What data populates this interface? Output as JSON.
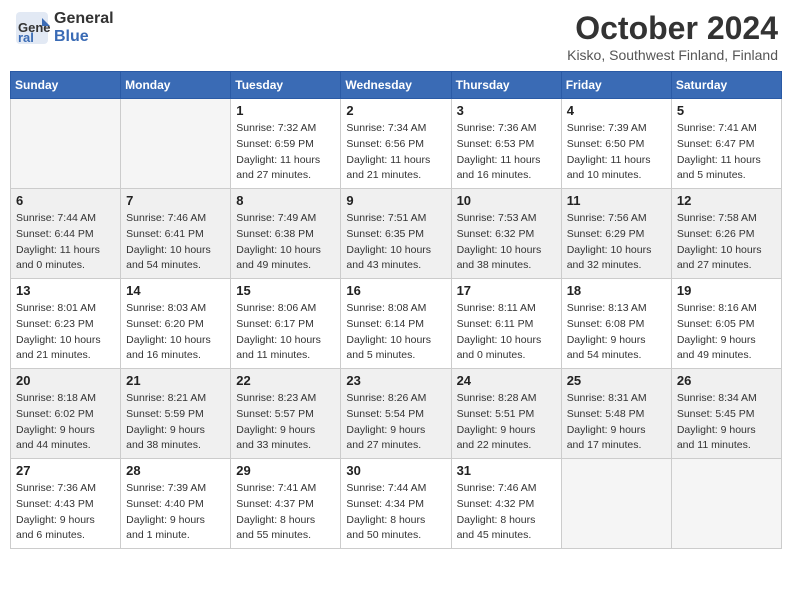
{
  "header": {
    "logo_line1": "General",
    "logo_line2": "Blue",
    "month": "October 2024",
    "location": "Kisko, Southwest Finland, Finland"
  },
  "weekdays": [
    "Sunday",
    "Monday",
    "Tuesday",
    "Wednesday",
    "Thursday",
    "Friday",
    "Saturday"
  ],
  "weeks": [
    [
      {
        "day": "",
        "info": ""
      },
      {
        "day": "",
        "info": ""
      },
      {
        "day": "1",
        "info": "Sunrise: 7:32 AM\nSunset: 6:59 PM\nDaylight: 11 hours and 27 minutes."
      },
      {
        "day": "2",
        "info": "Sunrise: 7:34 AM\nSunset: 6:56 PM\nDaylight: 11 hours and 21 minutes."
      },
      {
        "day": "3",
        "info": "Sunrise: 7:36 AM\nSunset: 6:53 PM\nDaylight: 11 hours and 16 minutes."
      },
      {
        "day": "4",
        "info": "Sunrise: 7:39 AM\nSunset: 6:50 PM\nDaylight: 11 hours and 10 minutes."
      },
      {
        "day": "5",
        "info": "Sunrise: 7:41 AM\nSunset: 6:47 PM\nDaylight: 11 hours and 5 minutes."
      }
    ],
    [
      {
        "day": "6",
        "info": "Sunrise: 7:44 AM\nSunset: 6:44 PM\nDaylight: 11 hours and 0 minutes."
      },
      {
        "day": "7",
        "info": "Sunrise: 7:46 AM\nSunset: 6:41 PM\nDaylight: 10 hours and 54 minutes."
      },
      {
        "day": "8",
        "info": "Sunrise: 7:49 AM\nSunset: 6:38 PM\nDaylight: 10 hours and 49 minutes."
      },
      {
        "day": "9",
        "info": "Sunrise: 7:51 AM\nSunset: 6:35 PM\nDaylight: 10 hours and 43 minutes."
      },
      {
        "day": "10",
        "info": "Sunrise: 7:53 AM\nSunset: 6:32 PM\nDaylight: 10 hours and 38 minutes."
      },
      {
        "day": "11",
        "info": "Sunrise: 7:56 AM\nSunset: 6:29 PM\nDaylight: 10 hours and 32 minutes."
      },
      {
        "day": "12",
        "info": "Sunrise: 7:58 AM\nSunset: 6:26 PM\nDaylight: 10 hours and 27 minutes."
      }
    ],
    [
      {
        "day": "13",
        "info": "Sunrise: 8:01 AM\nSunset: 6:23 PM\nDaylight: 10 hours and 21 minutes."
      },
      {
        "day": "14",
        "info": "Sunrise: 8:03 AM\nSunset: 6:20 PM\nDaylight: 10 hours and 16 minutes."
      },
      {
        "day": "15",
        "info": "Sunrise: 8:06 AM\nSunset: 6:17 PM\nDaylight: 10 hours and 11 minutes."
      },
      {
        "day": "16",
        "info": "Sunrise: 8:08 AM\nSunset: 6:14 PM\nDaylight: 10 hours and 5 minutes."
      },
      {
        "day": "17",
        "info": "Sunrise: 8:11 AM\nSunset: 6:11 PM\nDaylight: 10 hours and 0 minutes."
      },
      {
        "day": "18",
        "info": "Sunrise: 8:13 AM\nSunset: 6:08 PM\nDaylight: 9 hours and 54 minutes."
      },
      {
        "day": "19",
        "info": "Sunrise: 8:16 AM\nSunset: 6:05 PM\nDaylight: 9 hours and 49 minutes."
      }
    ],
    [
      {
        "day": "20",
        "info": "Sunrise: 8:18 AM\nSunset: 6:02 PM\nDaylight: 9 hours and 44 minutes."
      },
      {
        "day": "21",
        "info": "Sunrise: 8:21 AM\nSunset: 5:59 PM\nDaylight: 9 hours and 38 minutes."
      },
      {
        "day": "22",
        "info": "Sunrise: 8:23 AM\nSunset: 5:57 PM\nDaylight: 9 hours and 33 minutes."
      },
      {
        "day": "23",
        "info": "Sunrise: 8:26 AM\nSunset: 5:54 PM\nDaylight: 9 hours and 27 minutes."
      },
      {
        "day": "24",
        "info": "Sunrise: 8:28 AM\nSunset: 5:51 PM\nDaylight: 9 hours and 22 minutes."
      },
      {
        "day": "25",
        "info": "Sunrise: 8:31 AM\nSunset: 5:48 PM\nDaylight: 9 hours and 17 minutes."
      },
      {
        "day": "26",
        "info": "Sunrise: 8:34 AM\nSunset: 5:45 PM\nDaylight: 9 hours and 11 minutes."
      }
    ],
    [
      {
        "day": "27",
        "info": "Sunrise: 7:36 AM\nSunset: 4:43 PM\nDaylight: 9 hours and 6 minutes."
      },
      {
        "day": "28",
        "info": "Sunrise: 7:39 AM\nSunset: 4:40 PM\nDaylight: 9 hours and 1 minute."
      },
      {
        "day": "29",
        "info": "Sunrise: 7:41 AM\nSunset: 4:37 PM\nDaylight: 8 hours and 55 minutes."
      },
      {
        "day": "30",
        "info": "Sunrise: 7:44 AM\nSunset: 4:34 PM\nDaylight: 8 hours and 50 minutes."
      },
      {
        "day": "31",
        "info": "Sunrise: 7:46 AM\nSunset: 4:32 PM\nDaylight: 8 hours and 45 minutes."
      },
      {
        "day": "",
        "info": ""
      },
      {
        "day": "",
        "info": ""
      }
    ]
  ]
}
